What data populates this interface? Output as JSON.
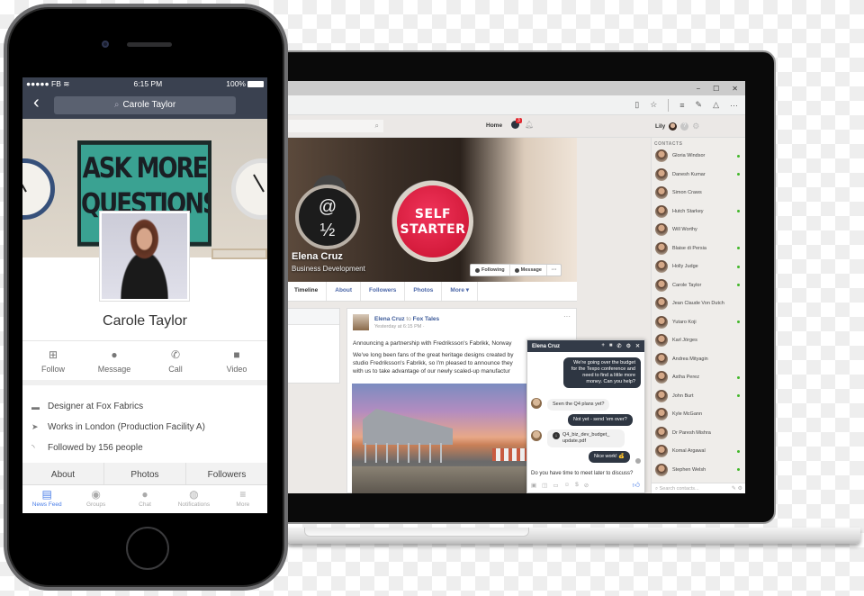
{
  "laptop": {
    "window_controls": {
      "minimize": "−",
      "maximize": "☐",
      "close": "✕"
    },
    "browser_toolbar_icons": [
      "reading-view",
      "favorite-star",
      "hub",
      "web-note",
      "share",
      "more"
    ],
    "app_header": {
      "search_icon": "⌕",
      "home_label": "Home",
      "chat_badge_count": "3",
      "user_name": "Lily",
      "help_icon": "?",
      "settings_icon": "⚙"
    },
    "cover": {
      "key1_top": "@",
      "key1_bottom": "½",
      "key2_text": "SELF STARTER",
      "name": "Elena Cruz",
      "role": "Business Development",
      "following_label": "Following",
      "message_label": "Message",
      "more_label": "···"
    },
    "profile_tabs": [
      {
        "label": "Timeline",
        "active": true
      },
      {
        "label": "About"
      },
      {
        "label": "Followers"
      },
      {
        "label": "Photos"
      },
      {
        "label": "More ▾"
      }
    ],
    "post": {
      "author": "Elena Cruz",
      "to_word": "to",
      "group": "Fox Tales",
      "timestamp": "Yesterday at 6:15 PM ·",
      "more": "···",
      "paragraph1": "Announcing a partnership with Fredriksson's Fabrikk, Norway",
      "paragraph2_lines": [
        "We've long been fans of the great heritage designs created by",
        "studio Fredriksson's Fabrikk, so I'm pleased to announce they",
        "with us to take advantage of our newly scaled-up manufactur"
      ]
    },
    "chat": {
      "title": "Elena Cruz",
      "header_icons": [
        "+",
        "video",
        "call",
        "settings",
        "close"
      ],
      "messages": [
        {
          "dir": "out",
          "text": "We're going over the budget for the Texpo conference and need to find a little more money. Can you help?"
        },
        {
          "dir": "in",
          "text": "Seen the Q4 plans yet?"
        },
        {
          "dir": "out",
          "text": "Not yet - send 'em over?"
        },
        {
          "dir": "in",
          "text": "Q4_biz_dev_budget_update.pdf",
          "attachment": true
        },
        {
          "dir": "out",
          "text": "Nice work! 💰"
        }
      ],
      "input_value": "Do you have time to meet later to discuss?",
      "tool_icons": [
        "photo",
        "sticker",
        "gif",
        "emoji",
        "payment",
        "attach"
      ],
      "like_icon": "👍"
    },
    "contacts": {
      "heading": "CONTACTS",
      "items": [
        {
          "name": "Gloria Windsor",
          "online": true
        },
        {
          "name": "Danesh Kumar",
          "online": true
        },
        {
          "name": "Simon Craws",
          "online": false
        },
        {
          "name": "Hutch Starkey",
          "online": true
        },
        {
          "name": "Will Worthy",
          "online": false
        },
        {
          "name": "Blaise di Persia",
          "online": true
        },
        {
          "name": "Holly Judge",
          "online": true
        },
        {
          "name": "Carole Taylor",
          "online": true
        },
        {
          "name": "Jean Claude Von Dutch",
          "online": false
        },
        {
          "name": "Yutaro Koji",
          "online": true
        },
        {
          "name": "Karl Jörges",
          "online": false
        },
        {
          "name": "Andrea Mityagin",
          "online": false
        },
        {
          "name": "Astha Perez",
          "online": true
        },
        {
          "name": "John Burt",
          "online": true
        },
        {
          "name": "Kyle McGann",
          "online": false
        },
        {
          "name": "Dr Paresh Mishra",
          "online": false
        },
        {
          "name": "Komal Argawal",
          "online": true
        },
        {
          "name": "Stephen Welsh",
          "online": true
        }
      ],
      "search_placeholder": "Search contacts..."
    }
  },
  "phone": {
    "status": {
      "carrier": "●●●●● FB",
      "wifi": "≋",
      "time": "6:15 PM",
      "battery": "100%"
    },
    "nav": {
      "back": "‹",
      "search_value": "Carole Taylor",
      "search_icon": "⌕"
    },
    "cover_poster_text": "ASK MORE QUESTIONS",
    "profile_name": "Carole Taylor",
    "actions": [
      {
        "label": "Follow",
        "icon": "⊞"
      },
      {
        "label": "Message",
        "icon": "●"
      },
      {
        "label": "Call",
        "icon": "✆"
      },
      {
        "label": "Video",
        "icon": "■"
      }
    ],
    "info": [
      {
        "icon": "▬",
        "text": "Designer at Fox Fabrics"
      },
      {
        "icon": "➤",
        "text": "Works in London (Production Facility A)"
      },
      {
        "icon": "◝",
        "text": "Followed by 156 people"
      }
    ],
    "subtabs": [
      "About",
      "Photos",
      "Followers"
    ],
    "tabbar": [
      {
        "label": "News Feed",
        "icon": "▤",
        "active": true
      },
      {
        "label": "Groups",
        "icon": "◉"
      },
      {
        "label": "Chat",
        "icon": "●"
      },
      {
        "label": "Notifications",
        "icon": "◍"
      },
      {
        "label": "More",
        "icon": "≡"
      }
    ],
    "colors": {
      "accent": "#4a7ee8",
      "header": "#3a4150"
    }
  }
}
